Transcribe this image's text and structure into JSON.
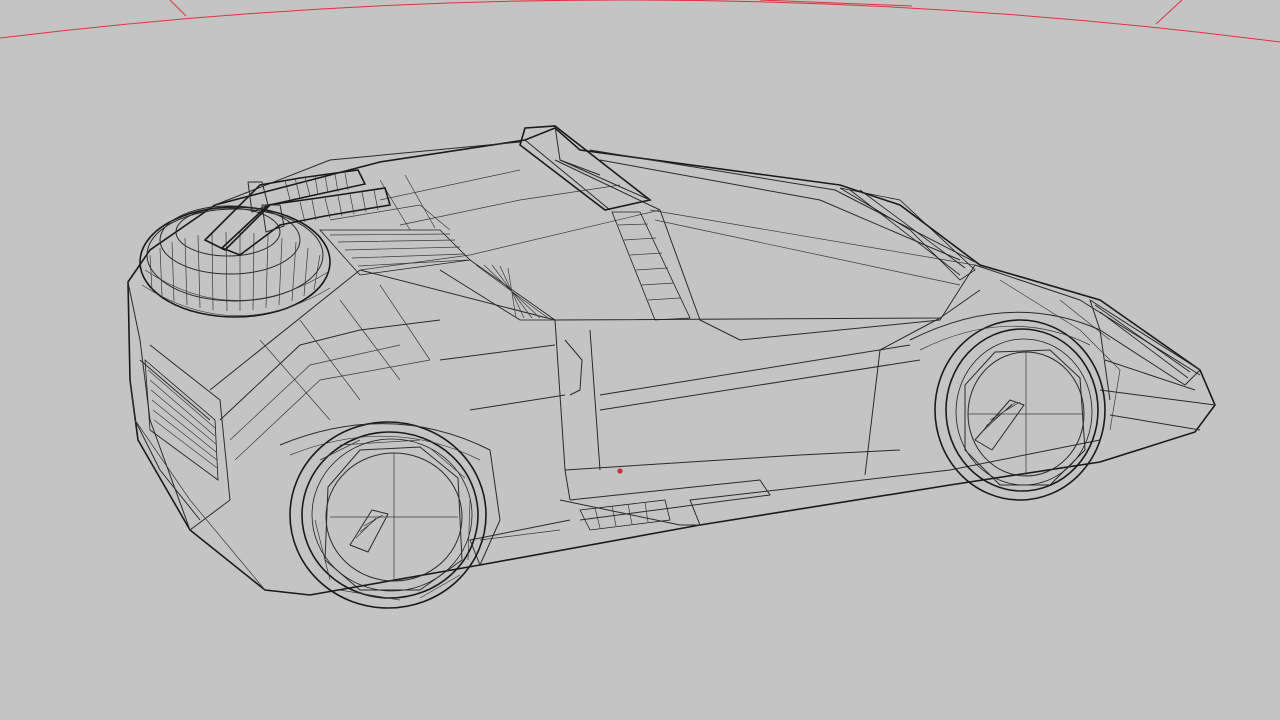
{
  "viewport": {
    "background": "#c4c4c4",
    "wire_color": "#2a2a2a",
    "guide_color": "#e0333d",
    "view_mode": "wireframe",
    "object": "futuristic-car-wireframe-model"
  }
}
